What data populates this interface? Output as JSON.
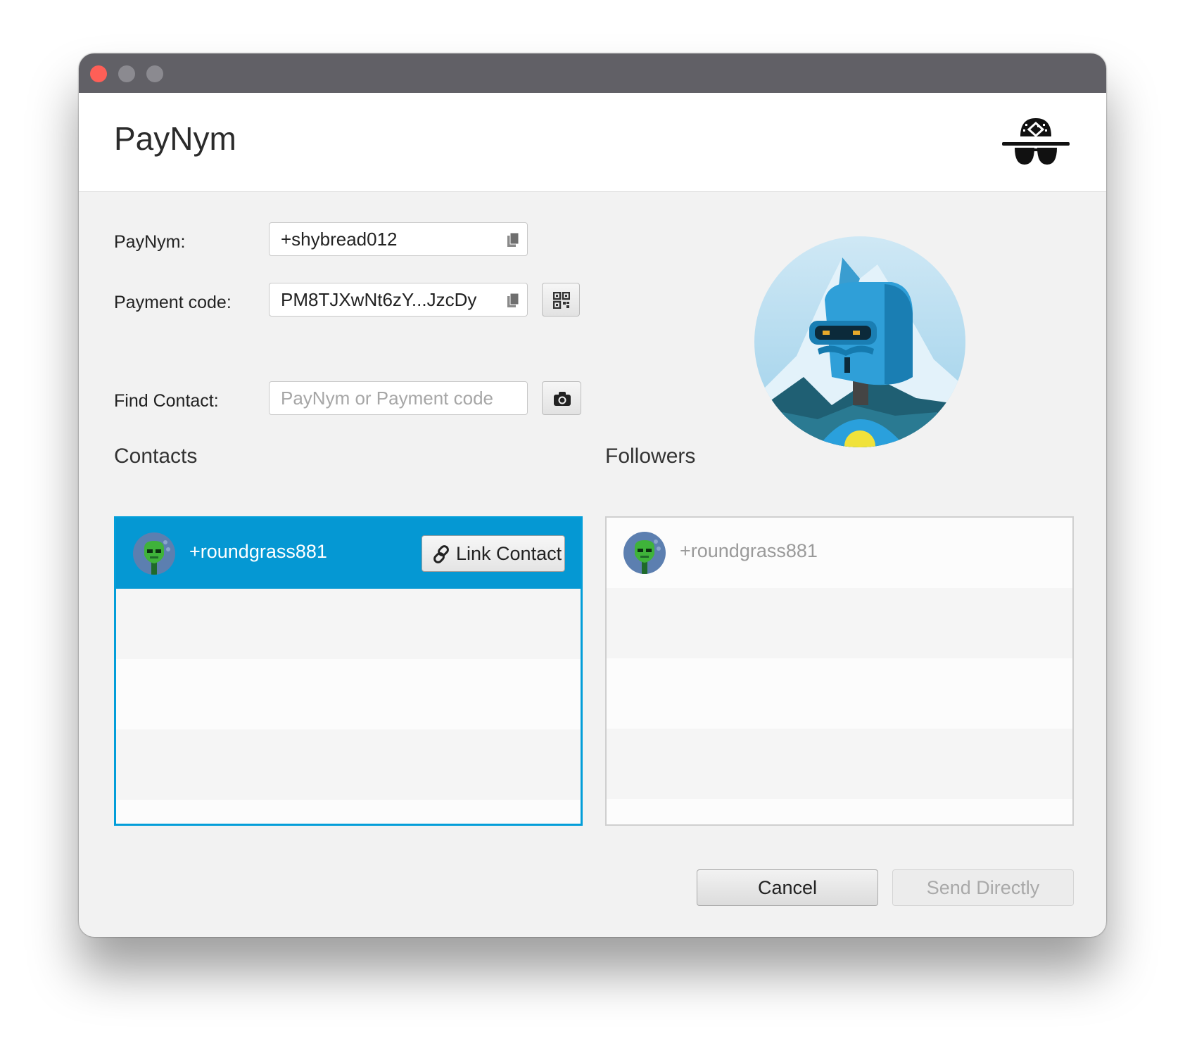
{
  "window": {
    "title": "PayNym"
  },
  "form": {
    "paynym_label": "PayNym:",
    "paynym_value": "+shybread012",
    "payment_code_label": "Payment code:",
    "payment_code_value": "PM8TJXwNt6zY...JzcDy",
    "find_contact_label": "Find Contact:",
    "find_contact_placeholder": "PayNym or Payment code"
  },
  "contacts": {
    "heading": "Contacts",
    "items": [
      {
        "nym": "+roundgrass881",
        "action_label": "Link Contact"
      }
    ]
  },
  "followers": {
    "heading": "Followers",
    "items": [
      {
        "nym": "+roundgrass881"
      }
    ]
  },
  "buttons": {
    "cancel": "Cancel",
    "send_directly": "Send Directly"
  },
  "icons": [
    "close-dot",
    "minimize-dot",
    "maximize-dot",
    "spy-hat-icon",
    "copy-icon",
    "qr-code-icon",
    "camera-icon",
    "link-icon"
  ],
  "colors": {
    "accent": "#0598d3",
    "titlebar": "#616066",
    "background": "#f2f2f2"
  }
}
